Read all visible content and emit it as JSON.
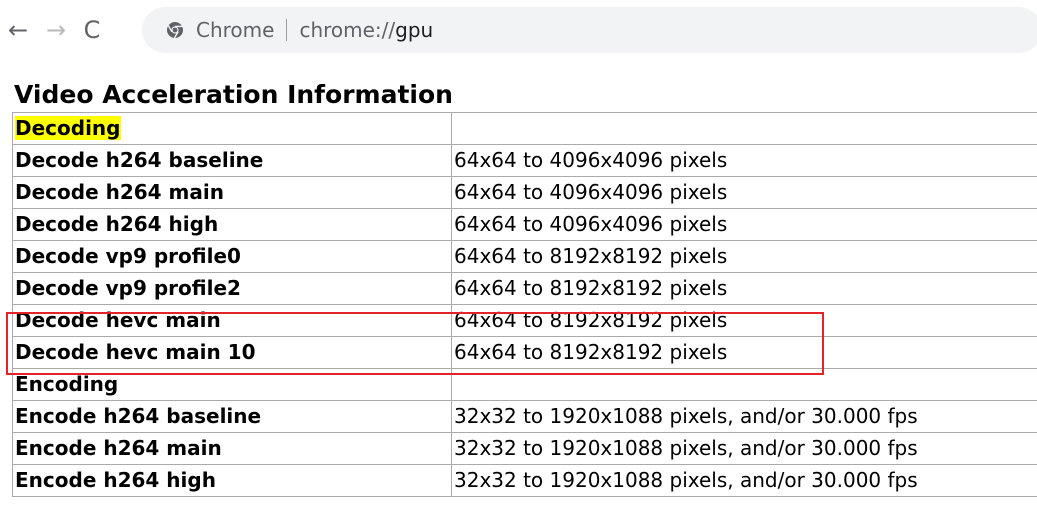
{
  "toolbar": {
    "back_icon": "←",
    "forward_icon": "→",
    "reload_icon": "C",
    "site_name": "Chrome",
    "url_scheme": "chrome://",
    "url_host": "gpu"
  },
  "page": {
    "title": "Video Acceleration Information",
    "rows": [
      {
        "key": "Decoding",
        "value": ""
      },
      {
        "key": "Decode h264 baseline",
        "value": "64x64 to 4096x4096 pixels"
      },
      {
        "key": "Decode h264 main",
        "value": "64x64 to 4096x4096 pixels"
      },
      {
        "key": "Decode h264 high",
        "value": "64x64 to 4096x4096 pixels"
      },
      {
        "key": "Decode vp9 profile0",
        "value": "64x64 to 8192x8192 pixels"
      },
      {
        "key": "Decode vp9 profile2",
        "value": "64x64 to 8192x8192 pixels"
      },
      {
        "key": "Decode hevc main",
        "value": "64x64 to 8192x8192 pixels"
      },
      {
        "key": "Decode hevc main 10",
        "value": "64x64 to 8192x8192 pixels"
      },
      {
        "key": "Encoding",
        "value": ""
      },
      {
        "key": "Encode h264 baseline",
        "value": "32x32 to 1920x1088 pixels, and/or 30.000 fps"
      },
      {
        "key": "Encode h264 main",
        "value": "32x32 to 1920x1088 pixels, and/or 30.000 fps"
      },
      {
        "key": "Encode h264 high",
        "value": "32x32 to 1920x1088 pixels, and/or 30.000 fps"
      }
    ]
  },
  "colors": {
    "highlight": "#ffff00",
    "annotation": "#e4222a"
  }
}
